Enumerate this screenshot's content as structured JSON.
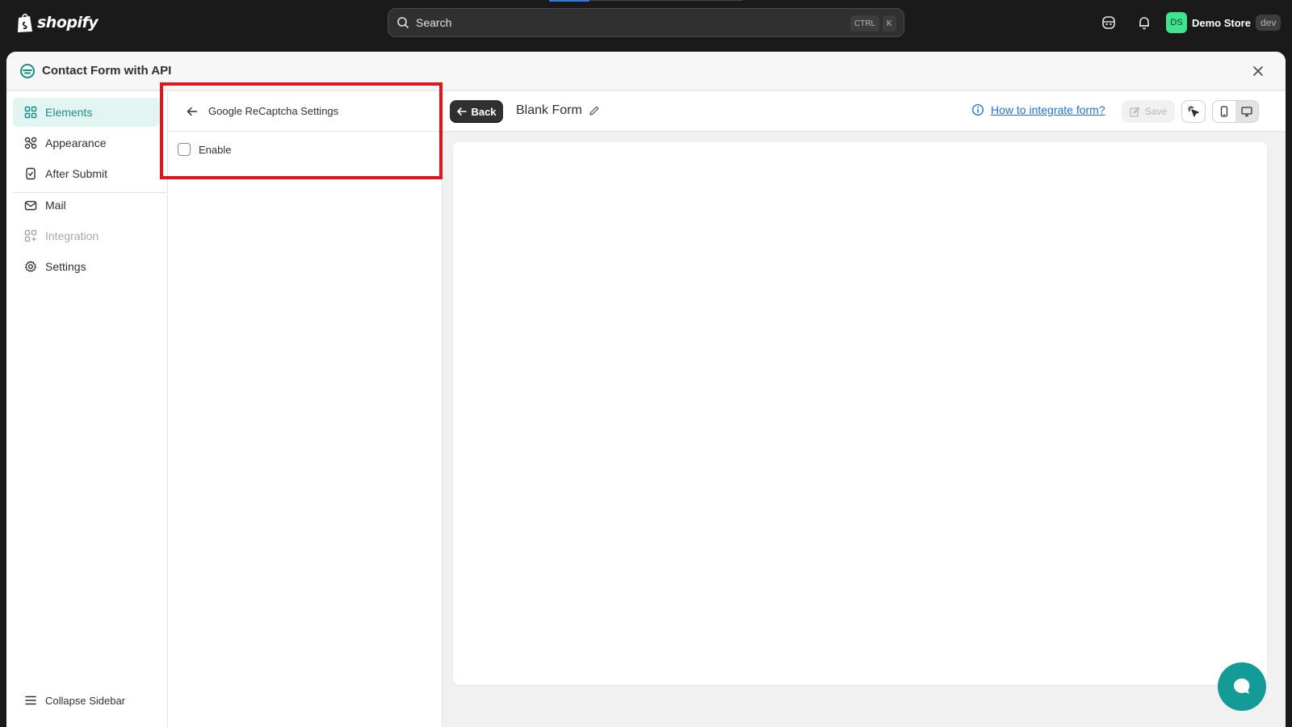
{
  "topbar": {
    "logo_text": "shopify",
    "search_placeholder": "Search",
    "kbd_ctrl": "CTRL",
    "kbd_k": "K",
    "store_initials": "DS",
    "store_name": "Demo Store",
    "store_badge": "dev"
  },
  "app": {
    "title": "Contact Form with API",
    "accent_color": "#1a8f85"
  },
  "nav": {
    "items": [
      {
        "label": "Elements",
        "icon": "elements-icon",
        "state": "active"
      },
      {
        "label": "Appearance",
        "icon": "appearance-icon",
        "state": "normal"
      },
      {
        "label": "After Submit",
        "icon": "after-submit-icon",
        "state": "normal"
      },
      {
        "label": "Mail",
        "icon": "mail-icon",
        "state": "normal"
      },
      {
        "label": "Integration",
        "icon": "integration-icon",
        "state": "disabled"
      },
      {
        "label": "Settings",
        "icon": "gear-icon",
        "state": "normal"
      }
    ],
    "collapse_label": "Collapse Sidebar"
  },
  "panel": {
    "title": "Google ReCaptcha Settings",
    "enable_label": "Enable",
    "enable_checked": false
  },
  "toolbar": {
    "back_label": "Back",
    "form_title": "Blank Form",
    "help_link": "How to integrate form?",
    "save_label": "Save"
  }
}
